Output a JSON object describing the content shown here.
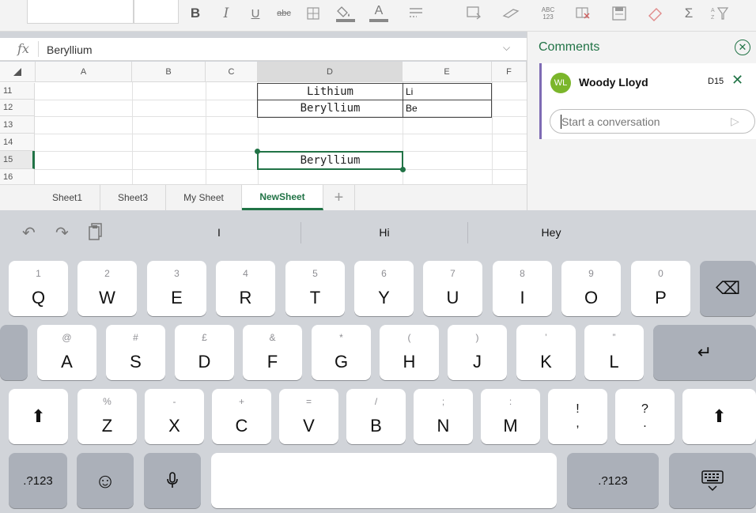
{
  "ribbon": {
    "icons": [
      "bold-icon",
      "italic-icon",
      "underline-icon",
      "strikethrough-icon",
      "borders-icon",
      "fill-color-icon",
      "font-color-icon",
      "align-icon",
      "wrap-icon",
      "format-painter-icon",
      "number-format-icon",
      "clear-format-icon",
      "merge-icon",
      "eraser-icon",
      "autosum-icon",
      "sort-filter-icon"
    ],
    "bold": "B",
    "italic": "I",
    "underline": "U",
    "strike": "abc",
    "font_color": "A",
    "sum": "Σ",
    "number_format": "ABC 123"
  },
  "formula_bar": {
    "fx_label": "fx",
    "value": "Beryllium"
  },
  "grid": {
    "columns": [
      "A",
      "B",
      "C",
      "D",
      "E",
      "F"
    ],
    "active_column": "D",
    "rows": [
      "11",
      "12",
      "13",
      "14",
      "15",
      "16"
    ],
    "active_row": "15",
    "cells": {
      "D11": "Lithium",
      "E11": "Li",
      "D12": "Beryllium",
      "E12": "Be",
      "D15": "Beryllium"
    }
  },
  "sheet_tabs": {
    "tabs": [
      "Sheet1",
      "Sheet3",
      "My Sheet",
      "NewSheet"
    ],
    "active": "NewSheet",
    "add_label": "+"
  },
  "comments": {
    "title": "Comments",
    "author_initials": "WL",
    "author": "Woody Lloyd",
    "cell_ref": "D15",
    "placeholder": "Start a conversation",
    "accent": "#217346",
    "card_accent": "#7e6bb4",
    "avatar_color": "#7bb62b"
  },
  "keyboard": {
    "predictions": [
      "I",
      "Hi",
      "Hey"
    ],
    "row1": [
      {
        "num": "1",
        "key": "Q"
      },
      {
        "num": "2",
        "key": "W"
      },
      {
        "num": "3",
        "key": "E"
      },
      {
        "num": "4",
        "key": "R"
      },
      {
        "num": "5",
        "key": "T"
      },
      {
        "num": "6",
        "key": "Y"
      },
      {
        "num": "7",
        "key": "U"
      },
      {
        "num": "8",
        "key": "I"
      },
      {
        "num": "9",
        "key": "O"
      },
      {
        "num": "0",
        "key": "P"
      }
    ],
    "row2": [
      {
        "num": "@",
        "key": "A"
      },
      {
        "num": "#",
        "key": "S"
      },
      {
        "num": "£",
        "key": "D"
      },
      {
        "num": "&",
        "key": "F"
      },
      {
        "num": "*",
        "key": "G"
      },
      {
        "num": "(",
        "key": "H"
      },
      {
        "num": ")",
        "key": "J"
      },
      {
        "num": "’",
        "key": "K"
      },
      {
        "num": "”",
        "key": "L"
      }
    ],
    "row3": [
      {
        "num": "%",
        "key": "Z"
      },
      {
        "num": "-",
        "key": "X"
      },
      {
        "num": "+",
        "key": "C"
      },
      {
        "num": "=",
        "key": "V"
      },
      {
        "num": "/",
        "key": "B"
      },
      {
        "num": ";",
        "key": "N"
      },
      {
        "num": ":",
        "key": "M"
      },
      {
        "num": "!",
        "key": ","
      },
      {
        "num": "?",
        "key": "."
      }
    ],
    "numbers_label": ".?123",
    "shift_glyph": "⬆",
    "backspace_glyph": "⌫",
    "return_glyph": "↵",
    "emoji_glyph": "☺"
  }
}
